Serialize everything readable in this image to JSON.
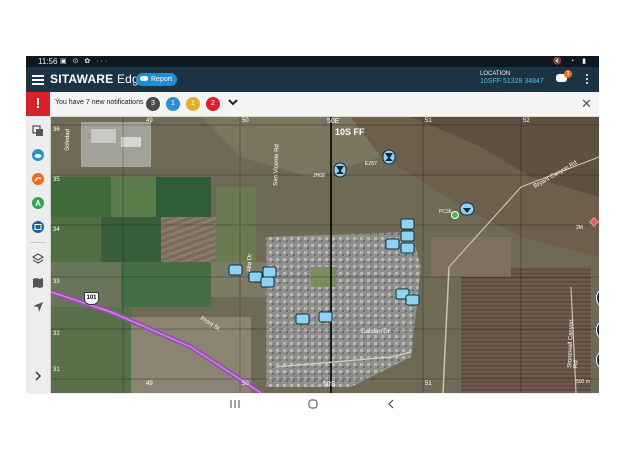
{
  "status_bar": {
    "time": "11:56",
    "icons": "▣ ⊙ ✿ ···",
    "right_icons": "🔇 ◔ ▮"
  },
  "app_bar": {
    "brand": "SITAWARE",
    "brand_suffix": "Edge",
    "report_label": "Report",
    "location_label": "LOCATION",
    "location_value": "10SFF 51328 34847",
    "chat_badge": "1"
  },
  "notifications": {
    "message": "You have 7 new notifications",
    "counts": [
      {
        "value": "3",
        "color": "#4a4a4a"
      },
      {
        "value": "1",
        "color": "#2c8fd0"
      },
      {
        "value": "1",
        "color": "#e2b02f"
      },
      {
        "value": "2",
        "color": "#d8222b"
      }
    ]
  },
  "sidebar": {
    "items": [
      "layers-stack-icon",
      "cloud-icon",
      "orange-route-icon",
      "green-a-icon",
      "blue-calendar-icon",
      "layers-icon",
      "map-icon",
      "navigate-icon",
      "chevron-right-icon"
    ]
  },
  "map": {
    "grid_labels": {
      "top_center_small": "50E",
      "top_center": "10S FF",
      "bottom_center": "50S",
      "col_top": [
        "49",
        "50",
        "51",
        "52"
      ],
      "col_bottom": [
        "49",
        "50",
        "51"
      ],
      "row": [
        "36",
        "35",
        "34",
        "33",
        "32",
        "31"
      ]
    },
    "roads": [
      "Front St",
      "Gabilan Dr",
      "Bryant Canyon Rd",
      "Stonewall Canyon Rd",
      "San Vicente Rd",
      "Soledad",
      "Alta Dr"
    ],
    "markers": [
      {
        "label": "JH09",
        "kind": "hostile-icon"
      },
      {
        "label": "EZ67",
        "kind": "hostile-icon"
      },
      {
        "label": "PC36",
        "kind": "friendly-icon"
      }
    ],
    "route_sign": "101",
    "scale_text": "500 m"
  },
  "colors": {
    "appbar": "#1c3344",
    "accent": "#1e8fd6",
    "alert": "#d8222b",
    "unit_fill": "#8fd3f2",
    "route": "#9a4bb5"
  }
}
